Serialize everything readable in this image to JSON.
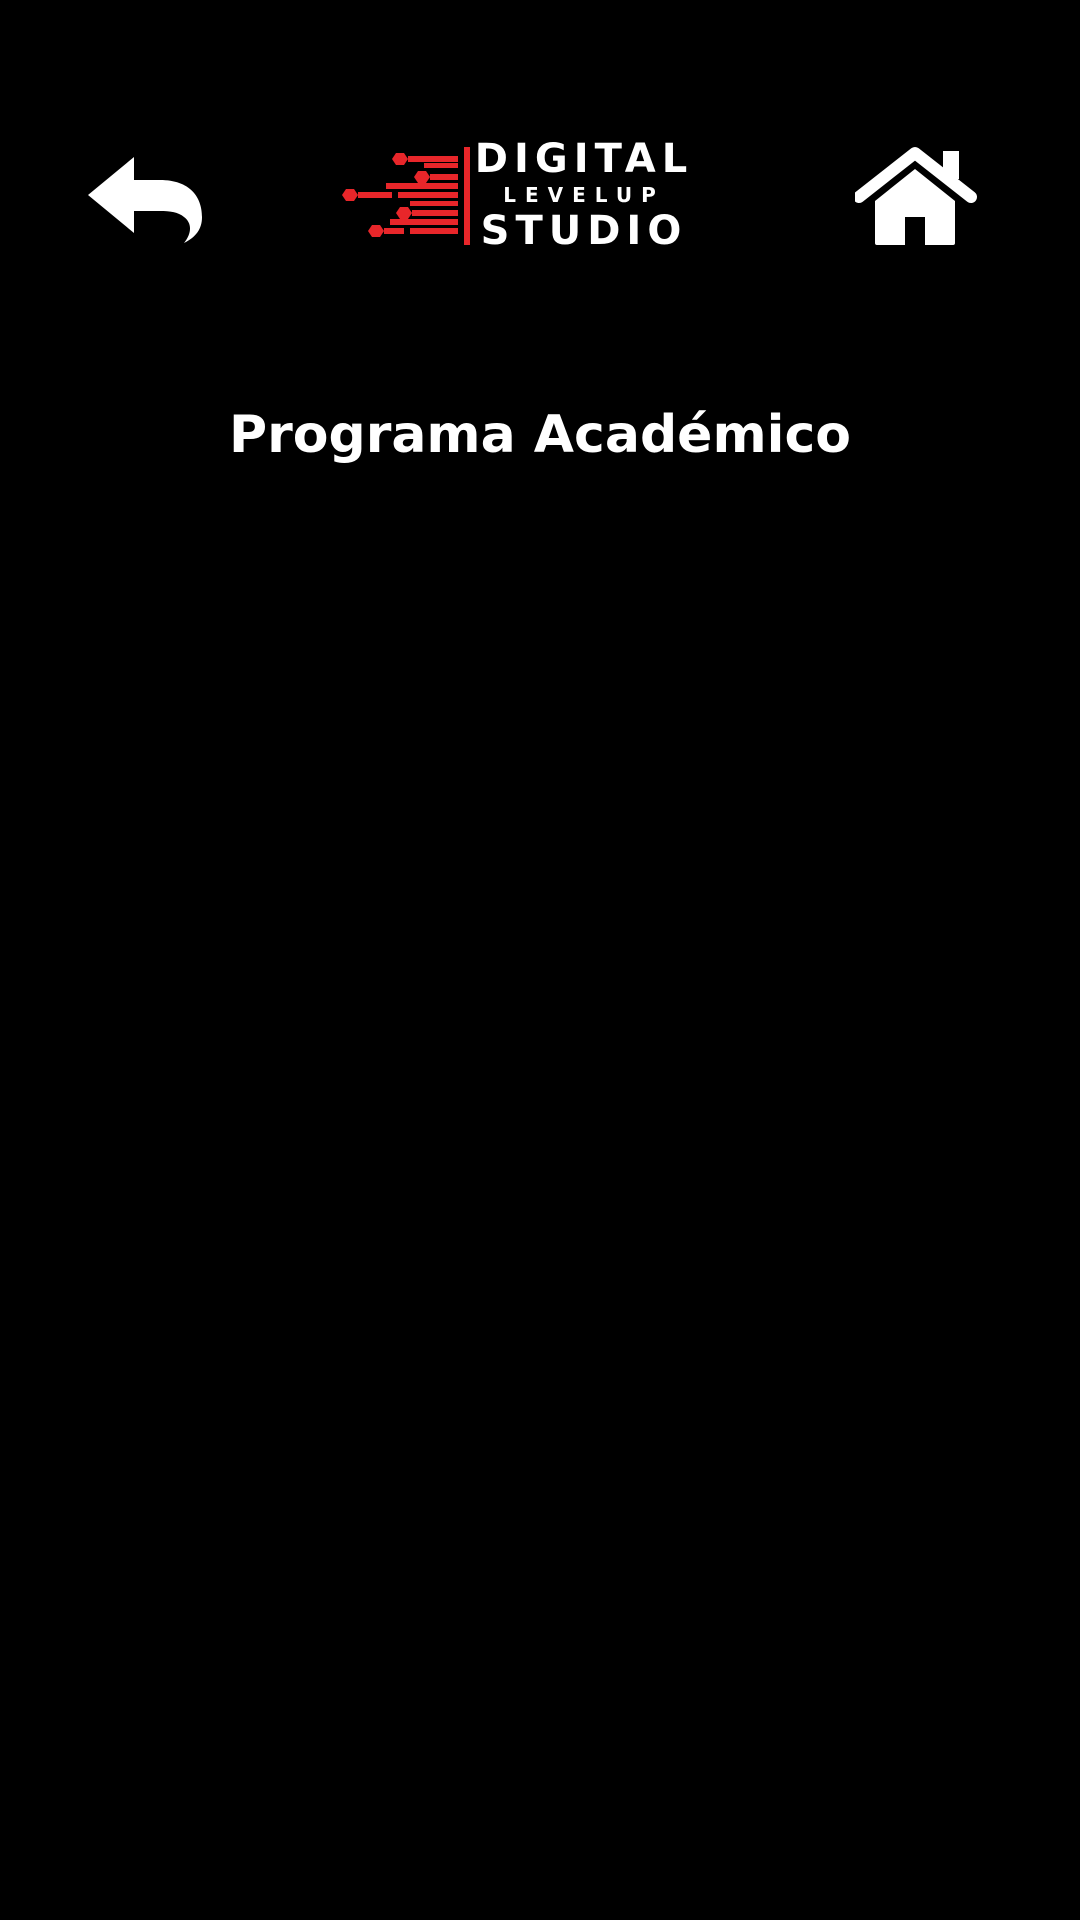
{
  "header": {
    "back_icon": "back-arrow-icon",
    "home_icon": "home-icon",
    "logo": {
      "line1": "DIGITAL",
      "line2": "LEVELUP",
      "line3": "STUDIO",
      "accent_color": "#e8262a",
      "text_color": "#ffffff"
    }
  },
  "main": {
    "title": "Programa Académico"
  },
  "theme": {
    "background": "#000000",
    "foreground": "#ffffff"
  }
}
